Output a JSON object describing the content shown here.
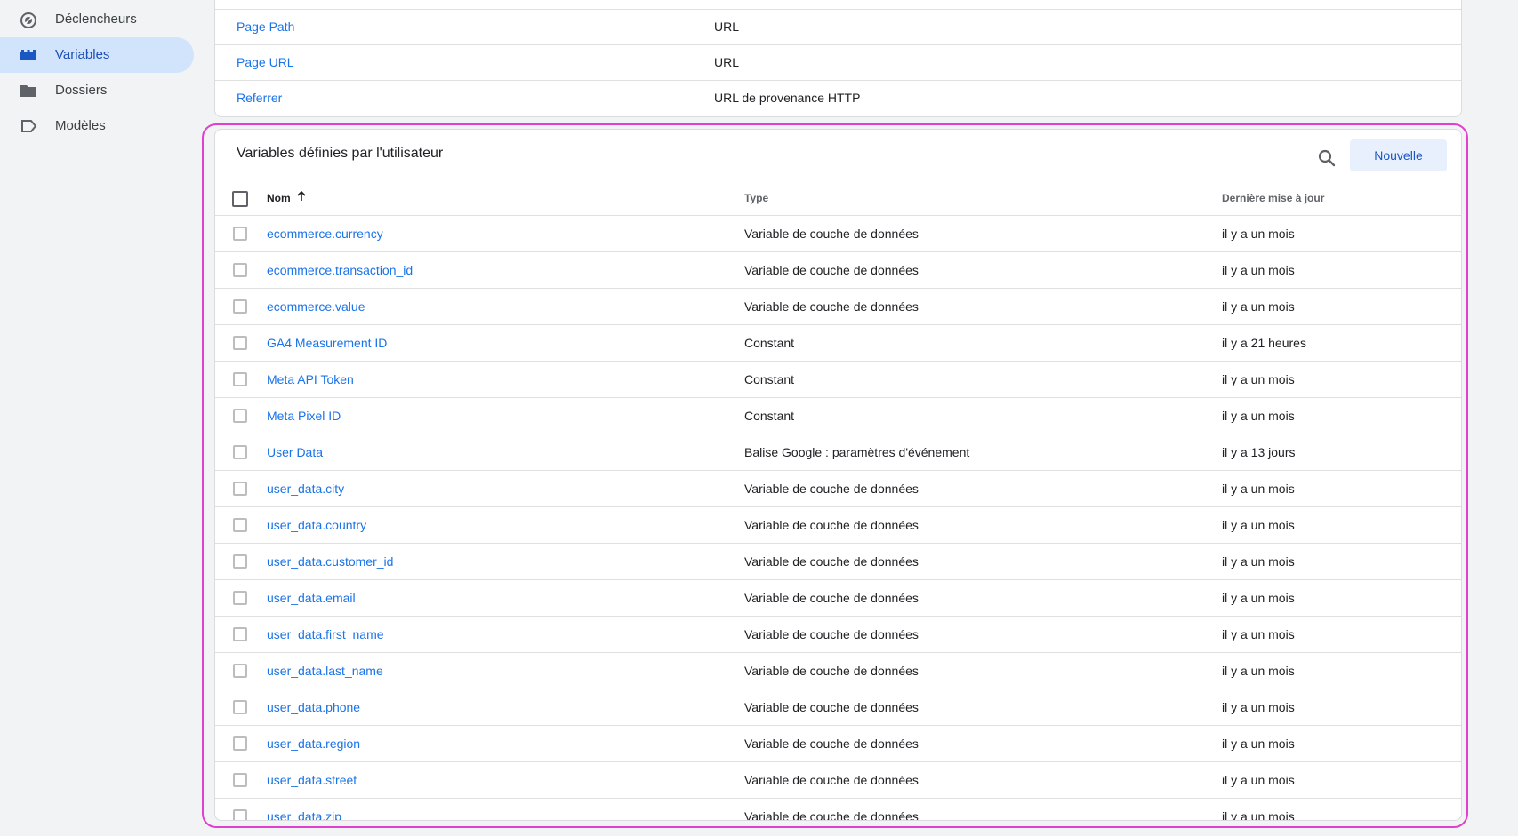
{
  "sidebar": {
    "items": [
      {
        "label": "Déclencheurs",
        "icon": "triggers-icon"
      },
      {
        "label": "Variables",
        "icon": "variables-icon",
        "active": true
      },
      {
        "label": "Dossiers",
        "icon": "folder-icon"
      },
      {
        "label": "Modèles",
        "icon": "templates-icon"
      }
    ]
  },
  "builtin_variables": {
    "rows": [
      {
        "name": "Page Path",
        "type": "URL"
      },
      {
        "name": "Page URL",
        "type": "URL"
      },
      {
        "name": "Referrer",
        "type": "URL de provenance HTTP"
      }
    ]
  },
  "user_variables": {
    "title": "Variables définies par l'utilisateur",
    "new_button": "Nouvelle",
    "columns": {
      "name": "Nom",
      "type": "Type",
      "updated": "Dernière mise à jour"
    },
    "rows": [
      {
        "name": "ecommerce.currency",
        "type": "Variable de couche de données",
        "updated": "il y a un mois"
      },
      {
        "name": "ecommerce.transaction_id",
        "type": "Variable de couche de données",
        "updated": "il y a un mois"
      },
      {
        "name": "ecommerce.value",
        "type": "Variable de couche de données",
        "updated": "il y a un mois"
      },
      {
        "name": "GA4 Measurement ID",
        "type": "Constant",
        "updated": "il y a 21 heures"
      },
      {
        "name": "Meta API Token",
        "type": "Constant",
        "updated": "il y a un mois"
      },
      {
        "name": "Meta Pixel ID",
        "type": "Constant",
        "updated": "il y a un mois"
      },
      {
        "name": "User Data",
        "type": "Balise Google : paramètres d'événement",
        "updated": "il y a 13 jours"
      },
      {
        "name": "user_data.city",
        "type": "Variable de couche de données",
        "updated": "il y a un mois"
      },
      {
        "name": "user_data.country",
        "type": "Variable de couche de données",
        "updated": "il y a un mois"
      },
      {
        "name": "user_data.customer_id",
        "type": "Variable de couche de données",
        "updated": "il y a un mois"
      },
      {
        "name": "user_data.email",
        "type": "Variable de couche de données",
        "updated": "il y a un mois"
      },
      {
        "name": "user_data.first_name",
        "type": "Variable de couche de données",
        "updated": "il y a un mois"
      },
      {
        "name": "user_data.last_name",
        "type": "Variable de couche de données",
        "updated": "il y a un mois"
      },
      {
        "name": "user_data.phone",
        "type": "Variable de couche de données",
        "updated": "il y a un mois"
      },
      {
        "name": "user_data.region",
        "type": "Variable de couche de données",
        "updated": "il y a un mois"
      },
      {
        "name": "user_data.street",
        "type": "Variable de couche de données",
        "updated": "il y a un mois"
      },
      {
        "name": "user_data.zip",
        "type": "Variable de couche de données",
        "updated": "il y a un mois"
      }
    ]
  },
  "colors": {
    "accent": "#1a73e8",
    "highlight": "#e040d0",
    "active_nav": "#d2e3fc"
  }
}
